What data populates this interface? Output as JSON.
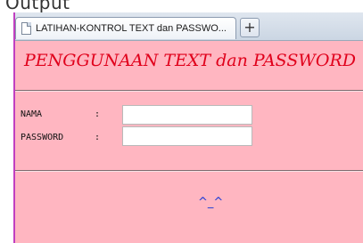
{
  "caption": "Output",
  "browser": {
    "tab_title": "LATIHAN-KONTROL TEXT dan PASSWO...",
    "new_tab_label": "+"
  },
  "page": {
    "heading": "PENGGUNAAN TEXT dan PASSWORD",
    "form": {
      "name_label": "NAMA",
      "name_colon": ":",
      "name_value": "",
      "password_label": "PASSWORD",
      "password_colon": ":",
      "password_value": ""
    },
    "footer_emoticon": "^_^"
  },
  "colors": {
    "page_background": "#ffb6c1",
    "heading_color": "#e0001b",
    "emoticon_color": "#1f3bd6"
  }
}
